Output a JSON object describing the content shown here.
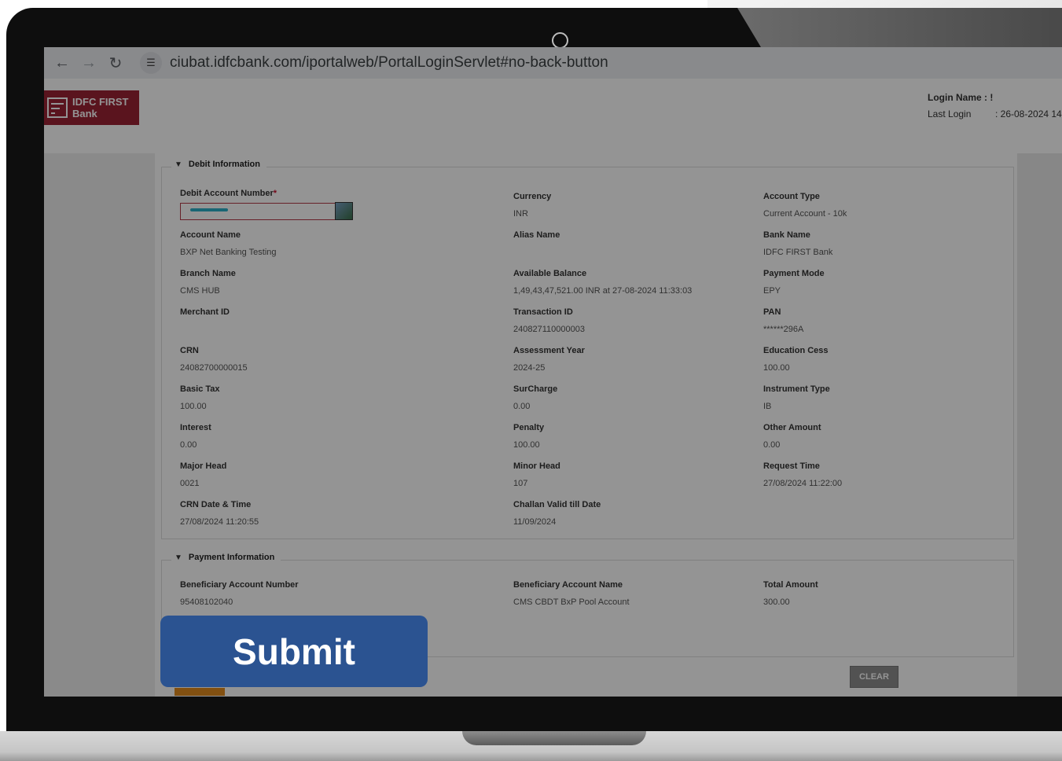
{
  "browser": {
    "url": "ciubat.idfcbank.com/iportalweb/PortalLoginServlet#no-back-button"
  },
  "header": {
    "logo_line1": "IDFC FIRST",
    "logo_line2": "Bank",
    "login_name_label": "Login Name : !",
    "last_login_label": "Last Login",
    "last_login_value": ": 26-08-2024 14"
  },
  "debit_section": {
    "title": "Debit Information",
    "account_number_label": "Debit Account Number",
    "required_mark": "*",
    "currency_label": "Currency",
    "currency_value": "INR",
    "account_type_label": "Account Type",
    "account_type_value": "Current Account - 10k",
    "account_name_label": "Account Name",
    "account_name_value": "BXP Net Banking Testing",
    "alias_name_label": "Alias Name",
    "alias_name_value": "",
    "bank_name_label": "Bank Name",
    "bank_name_value": "IDFC FIRST Bank",
    "branch_name_label": "Branch Name",
    "branch_name_value": "CMS HUB",
    "available_balance_label": "Available Balance",
    "available_balance_value": "1,49,43,47,521.00 INR at 27-08-2024 11:33:03",
    "payment_mode_label": "Payment Mode",
    "payment_mode_value": "EPY",
    "merchant_id_label": "Merchant ID",
    "merchant_id_value": "",
    "transaction_id_label": "Transaction ID",
    "transaction_id_value": "240827110000003",
    "pan_label": "PAN",
    "pan_value": "******296A",
    "crn_label": "CRN",
    "crn_value": "24082700000015",
    "assessment_year_label": "Assessment Year",
    "assessment_year_value": "2024-25",
    "education_cess_label": "Education Cess",
    "education_cess_value": "100.00",
    "basic_tax_label": "Basic Tax",
    "basic_tax_value": "100.00",
    "surcharge_label": "SurCharge",
    "surcharge_value": "0.00",
    "instrument_type_label": "Instrument Type",
    "instrument_type_value": "IB",
    "interest_label": "Interest",
    "interest_value": "0.00",
    "penalty_label": "Penalty",
    "penalty_value": "100.00",
    "other_amount_label": "Other Amount",
    "other_amount_value": "0.00",
    "major_head_label": "Major Head",
    "major_head_value": "0021",
    "minor_head_label": "Minor Head",
    "minor_head_value": "107",
    "request_time_label": "Request Time",
    "request_time_value": "27/08/2024 11:22:00",
    "crn_datetime_label": "CRN Date & Time",
    "crn_datetime_value": "27/08/2024 11:20:55",
    "challan_valid_label": "Challan Valid till Date",
    "challan_valid_value": "11/09/2024"
  },
  "payment_section": {
    "title": "Payment Information",
    "beneficiary_account_number_label": "Beneficiary Account Number",
    "beneficiary_account_number_value": "95408102040",
    "beneficiary_account_name_label": "Beneficiary Account Name",
    "beneficiary_account_name_value": "CMS CBDT BxP Pool Account",
    "total_amount_label": "Total Amount",
    "total_amount_value": "300.00"
  },
  "actions": {
    "clear_label": "CLEAR",
    "submit_label": "Submit"
  },
  "colors": {
    "brand": "#9b2335",
    "submit": "#2b5391"
  }
}
